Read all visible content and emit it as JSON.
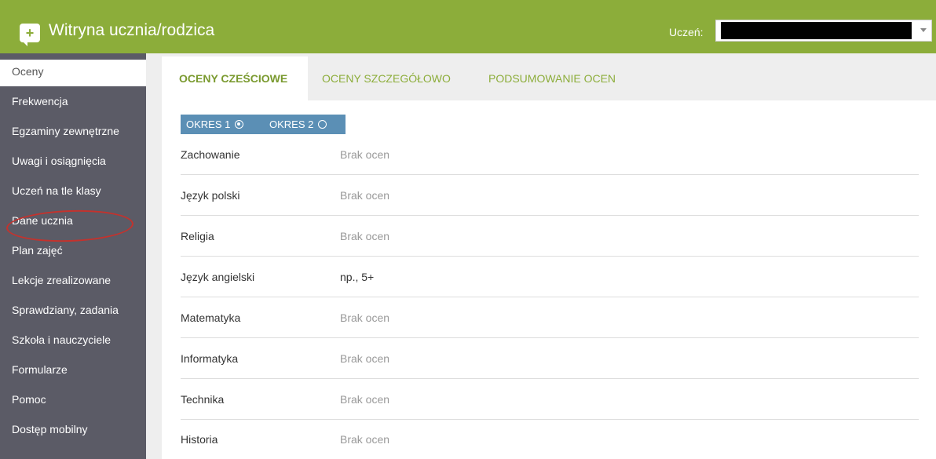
{
  "header": {
    "app_title": "Witryna ucznia/rodzica",
    "student_label": "Uczeń:",
    "student_value": ""
  },
  "sidebar": {
    "items": [
      {
        "label": "Oceny",
        "active": true
      },
      {
        "label": "Frekwencja"
      },
      {
        "label": "Egzaminy zewnętrzne"
      },
      {
        "label": "Uwagi i osiągnięcia"
      },
      {
        "label": "Uczeń na tle klasy"
      },
      {
        "label": "Dane ucznia",
        "highlighted": true
      },
      {
        "label": "Plan zajęć"
      },
      {
        "label": "Lekcje zrealizowane"
      },
      {
        "label": "Sprawdziany, zadania"
      },
      {
        "label": "Szkoła i nauczyciele"
      },
      {
        "label": "Formularze"
      },
      {
        "label": "Pomoc"
      },
      {
        "label": "Dostęp mobilny"
      }
    ]
  },
  "tabs": [
    {
      "label": "OCENY CZEŚCIOWE",
      "active": true
    },
    {
      "label": "OCENY SZCZEGÓŁOWO"
    },
    {
      "label": "PODSUMOWANIE OCEN"
    }
  ],
  "periods": [
    {
      "label": "OKRES 1",
      "selected": true
    },
    {
      "label": "OKRES 2",
      "selected": false
    }
  ],
  "subjects": [
    {
      "name": "Zachowanie",
      "grades": "Brak ocen"
    },
    {
      "name": "Język polski",
      "grades": "Brak ocen"
    },
    {
      "name": "Religia",
      "grades": "Brak ocen"
    },
    {
      "name": "Język angielski",
      "grades": "np., 5+"
    },
    {
      "name": "Matematyka",
      "grades": "Brak ocen"
    },
    {
      "name": "Informatyka",
      "grades": "Brak ocen"
    },
    {
      "name": "Technika",
      "grades": "Brak ocen"
    },
    {
      "name": "Historia",
      "grades": "Brak ocen"
    }
  ],
  "colors": {
    "brand_green": "#8cad3a",
    "sidebar_bg": "#5b5b66",
    "period_blue": "#5b8fb5",
    "annotation_red": "#c4322d"
  },
  "icons": {
    "app": "chat-plus-icon",
    "dropdown": "chevron-down-icon"
  }
}
